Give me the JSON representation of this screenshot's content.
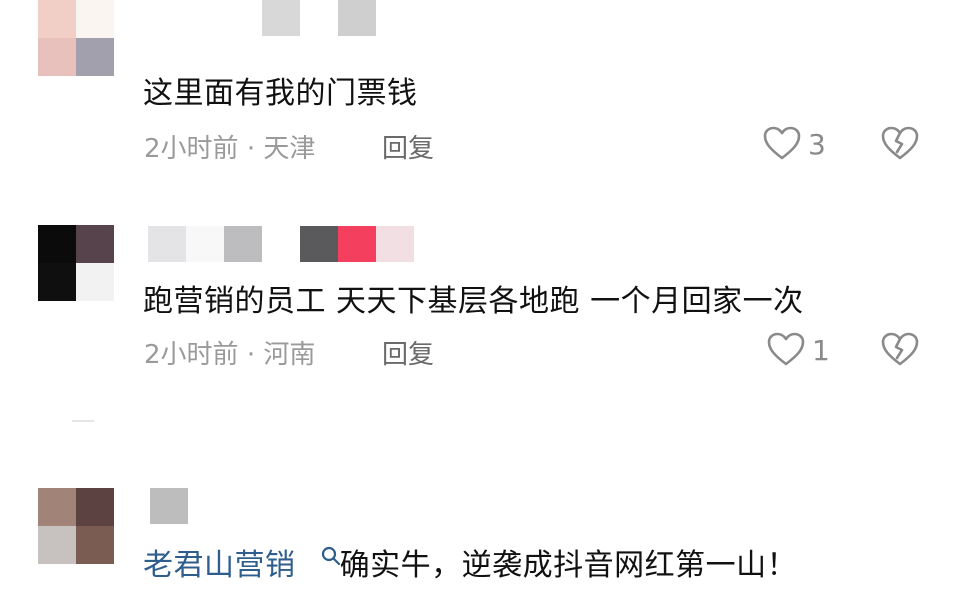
{
  "comments": [
    {
      "text": "这里面有我的门票钱",
      "time": "2小时前",
      "sep": "·",
      "location": "天津",
      "reply_label": "回复",
      "likes": "3",
      "avatar_colors": [
        "#f1cfc7",
        "#fbf5f1",
        "#e8c1bd",
        "#a3a0ad"
      ],
      "username_colors": [
        "#d8d8d8",
        "#cfcfcf"
      ]
    },
    {
      "text": "跑营销的员工 天天下基层各地跑 一个月回家一次",
      "time": "2小时前",
      "sep": "·",
      "location": "河南",
      "reply_label": "回复",
      "likes": "1",
      "avatar_colors": [
        "#0b0b0b",
        "#57434c",
        "#0f0f0f",
        "#f2f2f2"
      ],
      "username_colors": [
        "#e4e4e6",
        "#f8f8f8",
        "#bdbdbf",
        "#5a5a5c",
        "#f43f5e",
        "#f2dfe3"
      ]
    },
    {
      "link_text": "老君山营销",
      "text": "确实牛，逆袭成抖音网红第一山！",
      "avatar_colors": [
        "#a28377",
        "#5c4240",
        "#c7c2bf",
        "#7b5c52"
      ],
      "username_colors": [
        "#bdbdbd"
      ]
    }
  ],
  "colors": {
    "link": "#2f5e8d",
    "meta": "#9a9a9a",
    "icon": "#8a8a8a"
  },
  "icons": {
    "like": "heart-outline-icon",
    "dislike": "broken-heart-icon",
    "search": "search-icon"
  }
}
